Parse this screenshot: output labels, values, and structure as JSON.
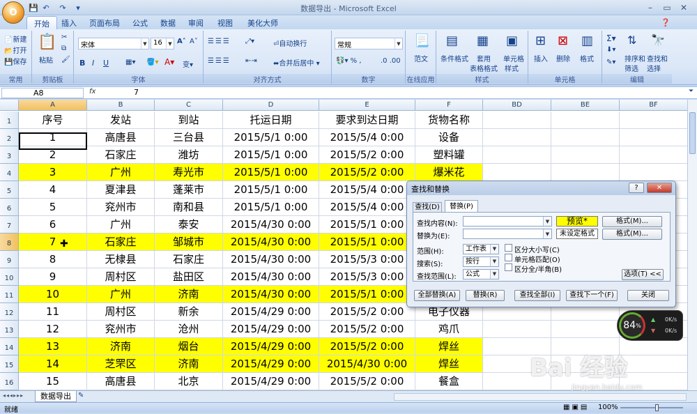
{
  "app": {
    "title": "数据导出 - Microsoft Excel",
    "logo": "Office button",
    "window_controls": [
      "minimize-icon",
      "restore-icon",
      "close-icon"
    ]
  },
  "ribbon": {
    "tabs": [
      "开始",
      "插入",
      "页面布局",
      "公式",
      "数据",
      "审阅",
      "视图",
      "美化大师"
    ],
    "active_tab": "开始",
    "clipboard": {
      "label": "剪贴板",
      "paste": "粘贴"
    },
    "font": {
      "label": "字体",
      "name": "宋体",
      "size": "16"
    },
    "alignment": {
      "label": "对齐方式",
      "wrap": "自动换行",
      "merge": "合并后居中"
    },
    "number": {
      "label": "数字",
      "format": "常规"
    },
    "online": {
      "label": "在线应用",
      "template": "范文"
    },
    "styles": {
      "label": "样式",
      "conditional": "条件格式",
      "table": "套用",
      "table2": "表格格式",
      "cell": "单元格",
      "cell2": "样式"
    },
    "cells": {
      "label": "单元格",
      "insert": "插入",
      "delete": "删除",
      "format": "格式"
    },
    "editing": {
      "label": "编辑",
      "sort": "排序和",
      "sort2": "筛选",
      "find": "查找和",
      "find2": "选择"
    },
    "common": {
      "label": "常用",
      "new": "新建",
      "open": "打开",
      "save": "保存"
    }
  },
  "formula_bar": {
    "name_box": "A8",
    "fx": "fx",
    "value": "7"
  },
  "sheet": {
    "columns": [
      "A",
      "B",
      "C",
      "D",
      "E",
      "F",
      "BD",
      "BE",
      "BF"
    ],
    "selected_column": "A",
    "headers": [
      "序号",
      "发站",
      "到站",
      "托运日期",
      "要求到达日期",
      "货物名称"
    ],
    "rows": [
      {
        "n": "1",
        "cells": [
          "序号",
          "发站",
          "到站",
          "托运日期",
          "要求到达日期",
          "货物名称"
        ],
        "hl": false
      },
      {
        "n": "2",
        "cells": [
          "1",
          "高唐县",
          "三台县",
          "2015/5/1  0:00",
          "2015/5/4  0:00",
          "设备"
        ],
        "hl": false
      },
      {
        "n": "3",
        "cells": [
          "2",
          "石家庄",
          "潍坊",
          "2015/5/1  0:00",
          "2015/5/2  0:00",
          "塑料罐"
        ],
        "hl": false
      },
      {
        "n": "4",
        "cells": [
          "3",
          "广州",
          "寿光市",
          "2015/5/1  0:00",
          "2015/5/2  0:00",
          "爆米花"
        ],
        "hl": true
      },
      {
        "n": "5",
        "cells": [
          "4",
          "夏津县",
          "蓬莱市",
          "2015/5/1  0:00",
          "2015/5/4  0:00",
          ""
        ],
        "hl": false
      },
      {
        "n": "6",
        "cells": [
          "5",
          "兖州市",
          "南和县",
          "2015/5/1  0:00",
          "2015/5/4  0:00",
          ""
        ],
        "hl": false
      },
      {
        "n": "7",
        "cells": [
          "6",
          "广州",
          "泰安",
          "2015/4/30  0:00",
          "2015/5/1  0:00",
          ""
        ],
        "hl": false
      },
      {
        "n": "8",
        "cells": [
          "7",
          "石家庄",
          "邹城市",
          "2015/4/30  0:00",
          "2015/5/1  0:00",
          ""
        ],
        "hl": true
      },
      {
        "n": "9",
        "cells": [
          "8",
          "无棣县",
          "石家庄",
          "2015/4/30  0:00",
          "2015/5/3  0:00",
          ""
        ],
        "hl": false
      },
      {
        "n": "10",
        "cells": [
          "9",
          "周村区",
          "盐田区",
          "2015/4/30  0:00",
          "2015/5/3  0:00",
          ""
        ],
        "hl": false
      },
      {
        "n": "11",
        "cells": [
          "10",
          "广州",
          "济南",
          "2015/4/30  0:00",
          "2015/5/1  0:00",
          ""
        ],
        "hl": true
      },
      {
        "n": "12",
        "cells": [
          "11",
          "周村区",
          "新余",
          "2015/4/29  0:00",
          "2015/5/2  0:00",
          "电子仪器"
        ],
        "hl": false
      },
      {
        "n": "13",
        "cells": [
          "12",
          "兖州市",
          "沧州",
          "2015/4/29  0:00",
          "2015/5/2  0:00",
          "鸡爪"
        ],
        "hl": false
      },
      {
        "n": "14",
        "cells": [
          "13",
          "济南",
          "烟台",
          "2015/4/29  0:00",
          "2015/5/2  0:00",
          "焊丝"
        ],
        "hl": true
      },
      {
        "n": "15",
        "cells": [
          "14",
          "芝罘区",
          "济南",
          "2015/4/29  0:00",
          "2015/4/30  0:00",
          "焊丝"
        ],
        "hl": true
      },
      {
        "n": "16",
        "cells": [
          "15",
          "高唐县",
          "北京",
          "2015/4/29  0:00",
          "2015/5/2  0:00",
          "餐盒"
        ],
        "hl": false
      }
    ],
    "selected_row": "8",
    "highlight_color": "#ffff00",
    "tab_name": "数据导出"
  },
  "dialog": {
    "title": "查找和替换",
    "help": "?",
    "tabs": [
      "查找(D)",
      "替换(P)"
    ],
    "active_tab": "替换(P)",
    "find_label": "查找内容(N):",
    "replace_label": "替换为(E):",
    "preview": "预览*",
    "no_format": "未设定格式",
    "format_btn": "格式(M)...",
    "format_btn2": "格式(M)...",
    "scope_label": "范围(H):",
    "scope_value": "工作表",
    "search_label": "搜索(S):",
    "search_value": "按行",
    "lookin_label": "查找范围(L):",
    "lookin_value": "公式",
    "match_case": "区分大小写(C)",
    "match_cell": "单元格匹配(O)",
    "match_byte": "区分全/半角(B)",
    "options_btn": "选项(T) <<",
    "replace_all": "全部替换(A)",
    "replace": "替换(R)",
    "find_all": "查找全部(I)",
    "find_next": "查找下一个(F)",
    "close": "关闭"
  },
  "status": {
    "ready": "就绪",
    "zoom": "100%"
  },
  "gadget": {
    "percent": "84",
    "unit": "%",
    "up": "0K/s",
    "down": "0K/s"
  },
  "watermark": {
    "text": "Bai 经验",
    "url": "jingyan.baidu.com"
  }
}
